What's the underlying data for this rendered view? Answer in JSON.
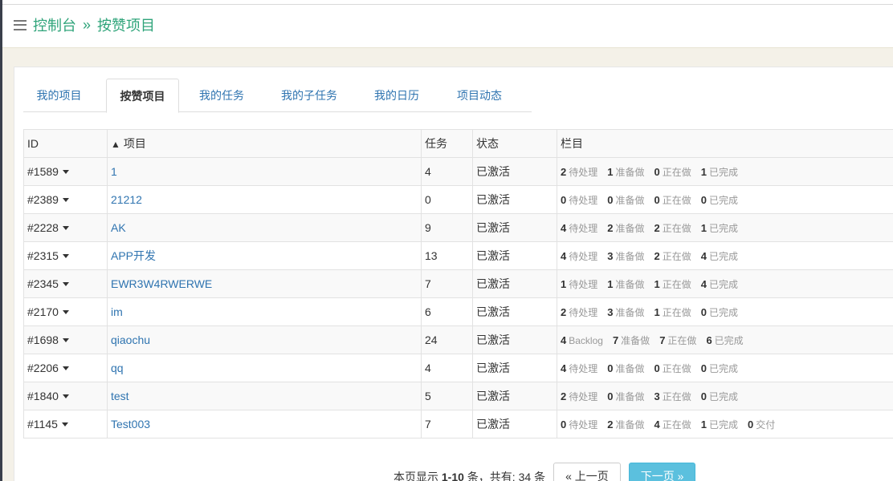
{
  "breadcrumb": {
    "root": "控制台",
    "separator": "»",
    "current": "按赞项目"
  },
  "tabs": [
    {
      "label": "我的项目"
    },
    {
      "label": "按赞项目"
    },
    {
      "label": "我的任务"
    },
    {
      "label": "我的子任务"
    },
    {
      "label": "我的日历"
    },
    {
      "label": "项目动态"
    }
  ],
  "table": {
    "headers": {
      "id": "ID",
      "sort_arrow": "▲",
      "project": "项目",
      "tasks": "任务",
      "status": "状态",
      "columns": "栏目"
    },
    "rows": [
      {
        "id": "#1589",
        "project": "1",
        "tasks": "4",
        "status": "已激活",
        "cols": [
          {
            "n": "2",
            "label": "待处理"
          },
          {
            "n": "1",
            "label": "准备做"
          },
          {
            "n": "0",
            "label": "正在做"
          },
          {
            "n": "1",
            "label": "已完成"
          }
        ]
      },
      {
        "id": "#2389",
        "project": "21212",
        "tasks": "0",
        "status": "已激活",
        "cols": [
          {
            "n": "0",
            "label": "待处理"
          },
          {
            "n": "0",
            "label": "准备做"
          },
          {
            "n": "0",
            "label": "正在做"
          },
          {
            "n": "0",
            "label": "已完成"
          }
        ]
      },
      {
        "id": "#2228",
        "project": "AK",
        "tasks": "9",
        "status": "已激活",
        "cols": [
          {
            "n": "4",
            "label": "待处理"
          },
          {
            "n": "2",
            "label": "准备做"
          },
          {
            "n": "2",
            "label": "正在做"
          },
          {
            "n": "1",
            "label": "已完成"
          }
        ]
      },
      {
        "id": "#2315",
        "project": "APP开发",
        "tasks": "13",
        "status": "已激活",
        "cols": [
          {
            "n": "4",
            "label": "待处理"
          },
          {
            "n": "3",
            "label": "准备做"
          },
          {
            "n": "2",
            "label": "正在做"
          },
          {
            "n": "4",
            "label": "已完成"
          }
        ]
      },
      {
        "id": "#2345",
        "project": "EWR3W4RWERWE",
        "tasks": "7",
        "status": "已激活",
        "cols": [
          {
            "n": "1",
            "label": "待处理"
          },
          {
            "n": "1",
            "label": "准备做"
          },
          {
            "n": "1",
            "label": "正在做"
          },
          {
            "n": "4",
            "label": "已完成"
          }
        ]
      },
      {
        "id": "#2170",
        "project": "im",
        "tasks": "6",
        "status": "已激活",
        "cols": [
          {
            "n": "2",
            "label": "待处理"
          },
          {
            "n": "3",
            "label": "准备做"
          },
          {
            "n": "1",
            "label": "正在做"
          },
          {
            "n": "0",
            "label": "已完成"
          }
        ]
      },
      {
        "id": "#1698",
        "project": "qiaochu",
        "tasks": "24",
        "status": "已激活",
        "cols": [
          {
            "n": "4",
            "label": "Backlog"
          },
          {
            "n": "7",
            "label": "准备做"
          },
          {
            "n": "7",
            "label": "正在做"
          },
          {
            "n": "6",
            "label": "已完成"
          }
        ]
      },
      {
        "id": "#2206",
        "project": "qq",
        "tasks": "4",
        "status": "已激活",
        "cols": [
          {
            "n": "4",
            "label": "待处理"
          },
          {
            "n": "0",
            "label": "准备做"
          },
          {
            "n": "0",
            "label": "正在做"
          },
          {
            "n": "0",
            "label": "已完成"
          }
        ]
      },
      {
        "id": "#1840",
        "project": "test",
        "tasks": "5",
        "status": "已激活",
        "cols": [
          {
            "n": "2",
            "label": "待处理"
          },
          {
            "n": "0",
            "label": "准备做"
          },
          {
            "n": "3",
            "label": "正在做"
          },
          {
            "n": "0",
            "label": "已完成"
          }
        ]
      },
      {
        "id": "#1145",
        "project": "Test003",
        "tasks": "7",
        "status": "已激活",
        "cols": [
          {
            "n": "0",
            "label": "待处理"
          },
          {
            "n": "2",
            "label": "准备做"
          },
          {
            "n": "4",
            "label": "正在做"
          },
          {
            "n": "1",
            "label": "已完成"
          },
          {
            "n": "0",
            "label": "交付"
          }
        ]
      }
    ]
  },
  "pagination": {
    "text_prefix": "本页显示",
    "range": "1-10",
    "text_mid": "条，共有:",
    "total": "34",
    "text_suffix": "条",
    "prev_label": "« 上一页",
    "next_label": "下一页 »"
  },
  "colors": {
    "accent": "#2fa47a",
    "link": "#2f74b0",
    "next_button": "#5bc0de"
  }
}
